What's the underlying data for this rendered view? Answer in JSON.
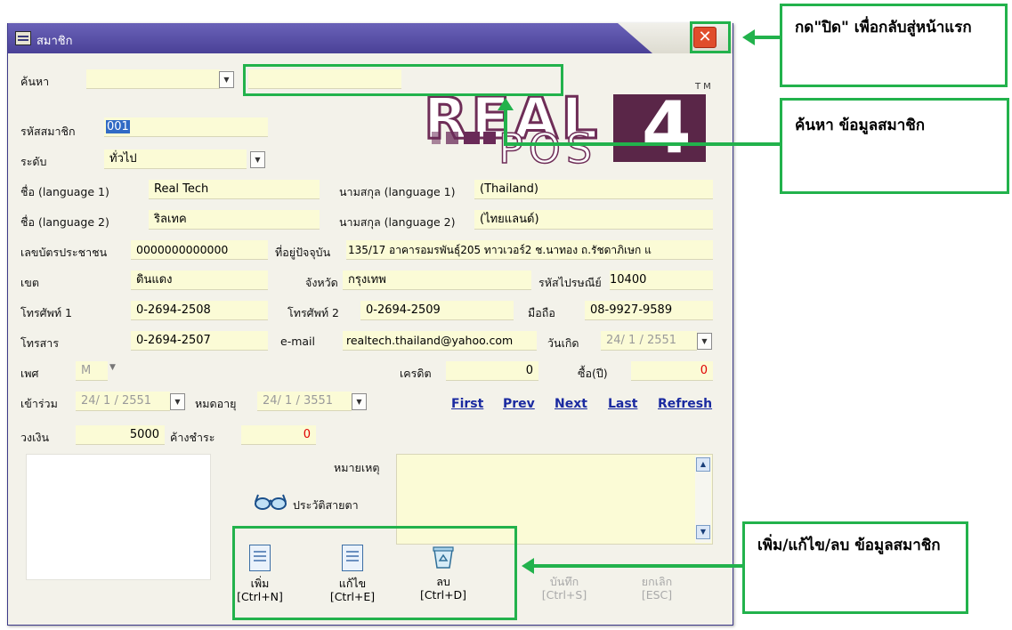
{
  "window": {
    "title": "สมาชิก",
    "close_label": "✕"
  },
  "search": {
    "label": "ค้นหา",
    "combo_value": "",
    "text_value": ""
  },
  "logo": {
    "text_real": "REAL",
    "text_pos": "POS",
    "text_4": "4",
    "tm": "TM"
  },
  "form": {
    "member_code_label": "รหัสสมาชิก",
    "member_code": "001",
    "level_label": "ระดับ",
    "level_value": "ทั่วไป",
    "name1_label": "ชื่อ (language 1)",
    "name1": "Real Tech",
    "surname1_label": "นามสกุล (language 1)",
    "surname1": "(Thailand)",
    "name2_label": "ชื่อ (language 2)",
    "name2": "ริลเทค",
    "surname2_label": "นามสกุล (language 2)",
    "surname2": "(ไทยแลนด์)",
    "id_card_label": "เลขบัตรประชาชน",
    "id_card": "0000000000000",
    "address_label": "ที่อยู่ปัจจุบัน",
    "address": "135/17 อาคารอมรพันธุ์205 ทาวเวอร์2 ช.นาทอง ถ.รัชดาภิเษก แ",
    "district_label": "เขต",
    "district": "ดินแดง",
    "province_label": "จังหวัด",
    "province": "กรุงเทพ",
    "postcode_label": "รหัสไปรษณีย์",
    "postcode": "10400",
    "phone1_label": "โทรศัพท์ 1",
    "phone1": "0-2694-2508",
    "phone2_label": "โทรศัพท์ 2",
    "phone2": "0-2694-2509",
    "mobile_label": "มือถือ",
    "mobile": "08-9927-9589",
    "fax_label": "โทรสาร",
    "fax": "0-2694-2507",
    "email_label": "e-mail",
    "email": "realtech.thailand@yahoo.com",
    "birthday_label": "วันเกิด",
    "birthday": "24/ 1 / 2551",
    "sex_label": "เพศ",
    "sex": "M",
    "credit_label": "เครดิต",
    "credit": "0",
    "buy_label": "ซื้อ(ปี)",
    "buy": "0",
    "join_label": "เข้าร่วม",
    "join": "24/ 1 / 2551",
    "expire_label": "หมดอายุ",
    "expire": "24/ 1 / 3551",
    "limit_label": "วงเงิน",
    "limit": "5000",
    "outstanding_label": "ค้างชำระ",
    "outstanding": "0",
    "note_label": "หมายเหตุ",
    "note": "",
    "eye_history_label": "ประวัติสายตา"
  },
  "nav": {
    "first": "First",
    "prev": "Prev",
    "next": "Next",
    "last": "Last",
    "refresh": "Refresh"
  },
  "toolbar": {
    "add_label": "เพิ่ม",
    "add_key": "[Ctrl+N]",
    "edit_label": "แก้ไข",
    "edit_key": "[Ctrl+E]",
    "delete_label": "ลบ",
    "delete_key": "[Ctrl+D]",
    "save_label": "บันทึก",
    "save_key": "[Ctrl+S]",
    "cancel_label": "ยกเลิก",
    "cancel_key": "[ESC]"
  },
  "callouts": {
    "close_note": "กด\"ปิด\" เพื่อกลับสู่หน้าแรก",
    "search_note": "ค้นหา ข้อมูลสมาชิก",
    "crud_note": "เพิ่ม/แก้ไข/ลบ ข้อมูลสมาชิก"
  },
  "colors": {
    "accent_green": "#22b24c",
    "field_bg": "#fbfbd6",
    "title_bar": "#4a4197",
    "logo": "#6e2d57"
  }
}
